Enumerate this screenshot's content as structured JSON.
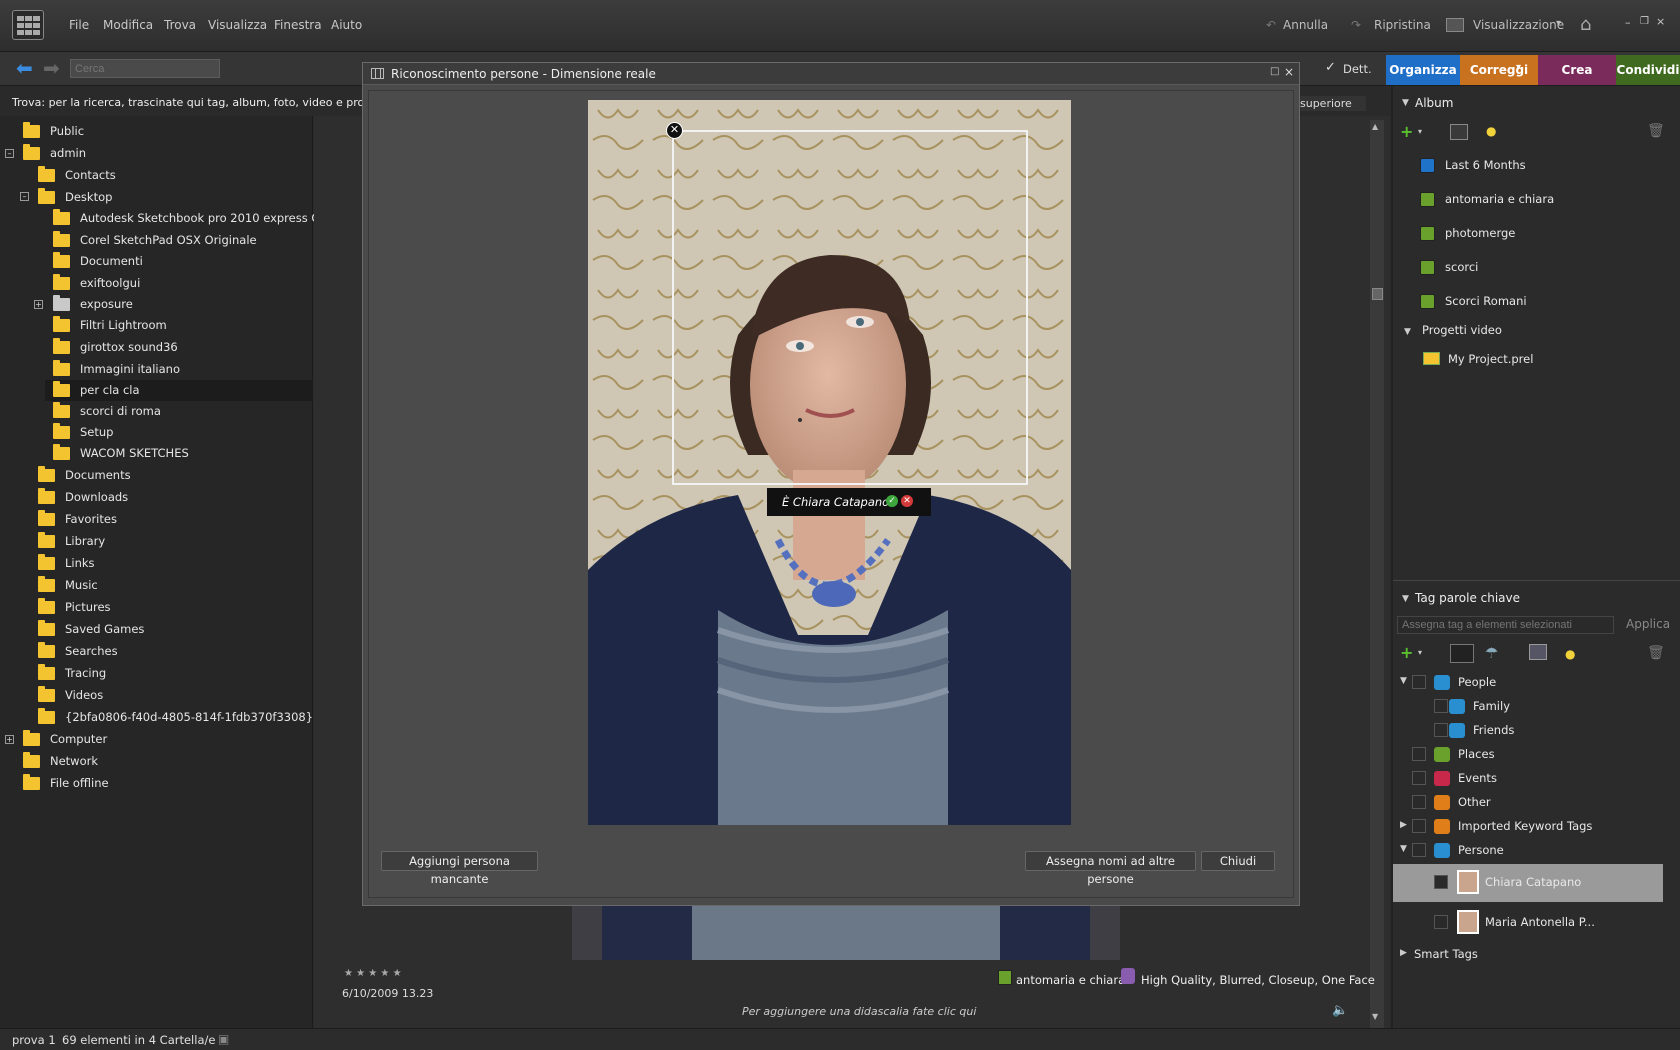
{
  "menu": [
    "File",
    "Modifica",
    "Trova",
    "Visualizza",
    "Finestra",
    "Aiuto"
  ],
  "toolbar": {
    "undo": "Annulla",
    "redo": "Ripristina",
    "view": "Visualizzazione"
  },
  "nav": {
    "search_placeholder": "Cerca",
    "details": "Dett."
  },
  "tabs": [
    {
      "label": "Organizza",
      "color": "#1f6fc9"
    },
    {
      "label": "Correggi",
      "color": "#c8711f"
    },
    {
      "label": "Crea",
      "color": "#7a2b5c"
    },
    {
      "label": "Condividi",
      "color": "#3f6a1f"
    }
  ],
  "findbar": {
    "text": "Trova: per la ricerca, trascinate qui tag, album, foto, video e proget",
    "sort": "superiore"
  },
  "tree": [
    {
      "label": "Public"
    },
    {
      "label": "admin"
    },
    {
      "label": "Contacts"
    },
    {
      "label": "Desktop"
    },
    {
      "label": "Autodesk Sketchbook pro 2010 express O..."
    },
    {
      "label": "Corel SketchPad  OSX Originale"
    },
    {
      "label": "Documenti"
    },
    {
      "label": "exiftoolgui"
    },
    {
      "label": "exposure"
    },
    {
      "label": "Filtri Lightroom"
    },
    {
      "label": "girottox sound36"
    },
    {
      "label": "Immagini italiano"
    },
    {
      "label": "per cla cla"
    },
    {
      "label": "scorci di roma"
    },
    {
      "label": "Setup"
    },
    {
      "label": "WACOM SKETCHES"
    },
    {
      "label": "Documents"
    },
    {
      "label": "Downloads"
    },
    {
      "label": "Favorites"
    },
    {
      "label": "Library"
    },
    {
      "label": "Links"
    },
    {
      "label": "Music"
    },
    {
      "label": "Pictures"
    },
    {
      "label": "Saved Games"
    },
    {
      "label": "Searches"
    },
    {
      "label": "Tracing"
    },
    {
      "label": "Videos"
    },
    {
      "label": "{2bfa0806-f40d-4805-814f-1fdb370f3308}"
    },
    {
      "label": "Computer"
    },
    {
      "label": "Network"
    },
    {
      "label": "File offline"
    }
  ],
  "dialog": {
    "title": "Riconoscimento persone - Dimensione reale",
    "face_prompt": "È Chiara Catapano?",
    "btn_add": "Aggiungi persona mancante",
    "btn_assign": "Assegna nomi ad altre persone",
    "btn_close": "Chiudi"
  },
  "photo_info": {
    "rating": "★ ★ ★ ★ ★",
    "date": "6/10/2009 13.23",
    "album": "antomaria e chiara",
    "tags": "High Quality, Blurred, Closeup, One Face",
    "caption": "Per aggiungere una didascalia fate clic qui"
  },
  "album_panel": {
    "title": "Album",
    "items": [
      {
        "label": "Last 6 Months",
        "color": "#1f74c9"
      },
      {
        "label": "antomaria e chiara",
        "color": "#6aa02c"
      },
      {
        "label": "photomerge",
        "color": "#6aa02c"
      },
      {
        "label": "scorci",
        "color": "#6aa02c"
      },
      {
        "label": "Scorci Romani",
        "color": "#6aa02c"
      }
    ],
    "video_group": "Progetti video",
    "video_item": "My Project.prel"
  },
  "tag_panel": {
    "title": "Tag parole chiave",
    "input_placeholder": "Assegna tag a elementi selezionati",
    "apply": "Applica",
    "items": [
      {
        "label": "People",
        "color": "#2a8fd0"
      },
      {
        "label": "Family",
        "color": "#2a8fd0"
      },
      {
        "label": "Friends",
        "color": "#2a8fd0"
      },
      {
        "label": "Places",
        "color": "#6aa02c"
      },
      {
        "label": "Events",
        "color": "#c8284a"
      },
      {
        "label": "Other",
        "color": "#e07f1a"
      },
      {
        "label": "Imported Keyword Tags",
        "color": "#e07f1a"
      },
      {
        "label": "Persone",
        "color": "#2a8fd0"
      },
      {
        "label": "Chiara Catapano"
      },
      {
        "label": "Maria Antonella P..."
      },
      {
        "label": "Smart Tags"
      }
    ]
  },
  "status": {
    "name": "prova 1",
    "count": "69 elementi in 4 Cartella/e"
  }
}
